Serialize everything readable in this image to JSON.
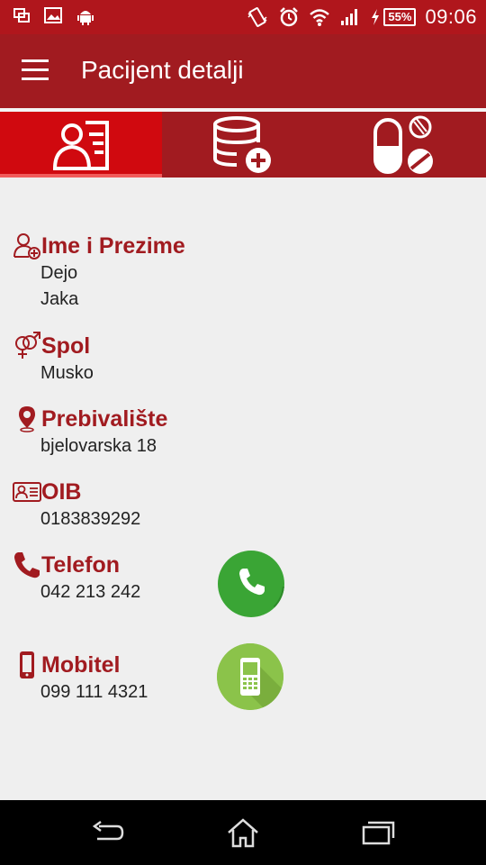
{
  "status_bar": {
    "icons_left": [
      "screen-icon",
      "image-icon",
      "android-icon"
    ],
    "icons_right": [
      "vibrate-icon",
      "alarm-icon",
      "wifi-icon",
      "signal-icon",
      "charging-icon"
    ],
    "battery": "55%",
    "time": "09:06"
  },
  "app_bar": {
    "title": "Pacijent detalji",
    "menu_icon": "hamburger-menu-icon"
  },
  "tabs": [
    {
      "icon": "patient-card-icon",
      "active": true
    },
    {
      "icon": "database-add-icon",
      "active": false
    },
    {
      "icon": "pills-icon",
      "active": false
    }
  ],
  "fields": {
    "name": {
      "label": "Ime i Prezime",
      "value_line1": "Dejo",
      "value_line2": "Jaka"
    },
    "gender": {
      "label": "Spol",
      "value": "Musko"
    },
    "residence": {
      "label": "Prebivalište",
      "value": "bjelovarska 18"
    },
    "oib": {
      "label": "OIB",
      "value": "0183839292"
    },
    "phone": {
      "label": "Telefon",
      "value": "042 213 242"
    },
    "mobile": {
      "label": "Mobitel",
      "value": "099 111 4321"
    }
  },
  "colors": {
    "primary": "#a11b20",
    "status_bar": "#b0161c",
    "tab_active": "#d0090f",
    "call_green": "#3aa535",
    "mobile_green": "#8bc34a",
    "background": "#efefef"
  },
  "nav_bar": {
    "buttons": [
      "back-icon",
      "home-icon",
      "recents-icon"
    ]
  }
}
